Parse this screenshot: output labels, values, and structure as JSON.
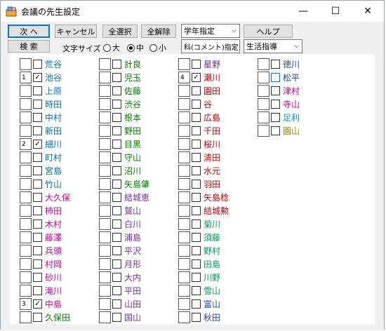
{
  "window": {
    "title": "会議の先生設定",
    "min": "—",
    "max": "☐",
    "close": "✕"
  },
  "toolbar": {
    "next": "次 へ",
    "cancel": "キャンセル",
    "select_all": "全選択",
    "deselect_all": "全解除",
    "grade_select": "学年指定",
    "help": "ヘルプ",
    "search": "検 索",
    "font_size_label": "文字サイズ",
    "size_options": [
      {
        "label": "大",
        "on": false
      },
      {
        "label": "中",
        "on": true
      },
      {
        "label": "小",
        "on": false
      }
    ],
    "subject_select": "科(コメント)指定",
    "life_select": "生活指導"
  },
  "columns": [
    [
      {
        "n": "",
        "c": false,
        "name": "荒谷",
        "color": "#0070c0"
      },
      {
        "n": "1",
        "c": true,
        "name": "池谷",
        "color": "#0070c0"
      },
      {
        "n": "",
        "c": false,
        "name": "上原",
        "color": "#0070c0"
      },
      {
        "n": "",
        "c": false,
        "name": "時田",
        "color": "#0070c0"
      },
      {
        "n": "",
        "c": false,
        "name": "中村",
        "color": "#0070c0"
      },
      {
        "n": "",
        "c": false,
        "name": "新田",
        "color": "#0070c0"
      },
      {
        "n": "2",
        "c": true,
        "name": "細川",
        "color": "#0070c0"
      },
      {
        "n": "",
        "c": false,
        "name": "町村",
        "color": "#0070c0"
      },
      {
        "n": "",
        "c": false,
        "name": "宮島",
        "color": "#0070c0"
      },
      {
        "n": "",
        "c": false,
        "name": "竹山",
        "color": "#0070c0"
      },
      {
        "n": "",
        "c": false,
        "name": "大久保",
        "color": "#cc0099"
      },
      {
        "n": "",
        "c": false,
        "name": "柿田",
        "color": "#cc0099"
      },
      {
        "n": "",
        "c": false,
        "name": "木村",
        "color": "#cc0099"
      },
      {
        "n": "",
        "c": false,
        "name": "藤澤",
        "color": "#cc0099"
      },
      {
        "n": "",
        "c": false,
        "name": "兵頭",
        "color": "#cc0099"
      },
      {
        "n": "",
        "c": false,
        "name": "村岡",
        "color": "#cc0099"
      },
      {
        "n": "",
        "c": false,
        "name": "砂川",
        "color": "#cc0099"
      },
      {
        "n": "",
        "c": false,
        "name": "滝川",
        "color": "#cc0099"
      },
      {
        "n": "3",
        "c": true,
        "name": "中島",
        "color": "#cc0099"
      },
      {
        "n": "",
        "c": false,
        "name": "久保田",
        "color": "#008000"
      }
    ],
    [
      {
        "n": "",
        "c": false,
        "name": "計良",
        "color": "#008000"
      },
      {
        "n": "",
        "c": false,
        "name": "児玉",
        "color": "#008000"
      },
      {
        "n": "",
        "c": false,
        "name": "佐藤",
        "color": "#008000"
      },
      {
        "n": "",
        "c": false,
        "name": "渋谷",
        "color": "#008000"
      },
      {
        "n": "",
        "c": false,
        "name": "根本",
        "color": "#008000"
      },
      {
        "n": "",
        "c": false,
        "name": "野田",
        "color": "#008000"
      },
      {
        "n": "",
        "c": false,
        "name": "目黒",
        "color": "#008000"
      },
      {
        "n": "",
        "c": false,
        "name": "守山",
        "color": "#008000"
      },
      {
        "n": "",
        "c": false,
        "name": "沼川",
        "color": "#008000"
      },
      {
        "n": "",
        "c": false,
        "name": "矢島肇",
        "color": "#008000"
      },
      {
        "n": "",
        "c": false,
        "name": "結城恵",
        "color": "#7030a0"
      },
      {
        "n": "",
        "c": false,
        "name": "鷲山",
        "color": "#7030a0"
      },
      {
        "n": "",
        "c": false,
        "name": "白川",
        "color": "#7030a0"
      },
      {
        "n": "",
        "c": false,
        "name": "浦島",
        "color": "#7030a0"
      },
      {
        "n": "",
        "c": false,
        "name": "平沢",
        "color": "#7030a0"
      },
      {
        "n": "",
        "c": false,
        "name": "月形",
        "color": "#7030a0"
      },
      {
        "n": "",
        "c": false,
        "name": "大内",
        "color": "#7030a0"
      },
      {
        "n": "",
        "c": false,
        "name": "平田",
        "color": "#7030a0"
      },
      {
        "n": "",
        "c": false,
        "name": "山田",
        "color": "#7030a0"
      },
      {
        "n": "",
        "c": false,
        "name": "国山",
        "color": "#7030a0"
      }
    ],
    [
      {
        "n": "",
        "c": false,
        "name": "星野",
        "color": "#7030a0"
      },
      {
        "n": "4",
        "c": true,
        "name": "瀬川",
        "color": "#c00000"
      },
      {
        "n": "",
        "c": false,
        "name": "園田",
        "color": "#c00000"
      },
      {
        "n": "",
        "c": false,
        "name": "谷",
        "color": "#c00000"
      },
      {
        "n": "",
        "c": false,
        "name": "広島",
        "color": "#c00000"
      },
      {
        "n": "",
        "c": false,
        "name": "千田",
        "color": "#c00000"
      },
      {
        "n": "",
        "c": false,
        "name": "桜川",
        "color": "#c00000"
      },
      {
        "n": "",
        "c": false,
        "name": "清田",
        "color": "#c00000"
      },
      {
        "n": "",
        "c": false,
        "name": "水元",
        "color": "#c00000"
      },
      {
        "n": "",
        "c": false,
        "name": "羽田",
        "color": "#c00000"
      },
      {
        "n": "",
        "c": false,
        "name": "矢島稔",
        "color": "#c00000"
      },
      {
        "n": "",
        "c": false,
        "name": "結城勲",
        "color": "#c00000"
      },
      {
        "n": "",
        "c": false,
        "name": "菊川",
        "color": "#00a050"
      },
      {
        "n": "",
        "c": false,
        "name": "須藤",
        "color": "#00a050"
      },
      {
        "n": "",
        "c": false,
        "name": "野村",
        "color": "#00a050"
      },
      {
        "n": "",
        "c": false,
        "name": "田島",
        "color": "#00a050"
      },
      {
        "n": "",
        "c": false,
        "name": "川野",
        "color": "#00a050"
      },
      {
        "n": "",
        "c": false,
        "name": "雪山",
        "color": "#00a050"
      },
      {
        "n": "",
        "c": false,
        "name": "富山",
        "color": "#1f3fb0"
      },
      {
        "n": "",
        "c": false,
        "name": "秋田",
        "color": "#1f3fb0"
      }
    ],
    [
      {
        "n": "",
        "c": false,
        "name": "徳川",
        "color": "#1f3fb0",
        "focus": false
      },
      {
        "n": "",
        "c": false,
        "name": "松平",
        "color": "#1f3fb0",
        "focus": true
      },
      {
        "n": "",
        "c": false,
        "name": "津村",
        "color": "#cc0099",
        "focus": false
      },
      {
        "n": "",
        "c": false,
        "name": "寺山",
        "color": "#cc0099",
        "focus": false
      },
      {
        "n": "",
        "c": false,
        "name": "足利",
        "color": "#00a0a0",
        "focus": false
      },
      {
        "n": "",
        "c": false,
        "name": "園山",
        "color": "#8b8b00",
        "focus": false
      }
    ]
  ]
}
